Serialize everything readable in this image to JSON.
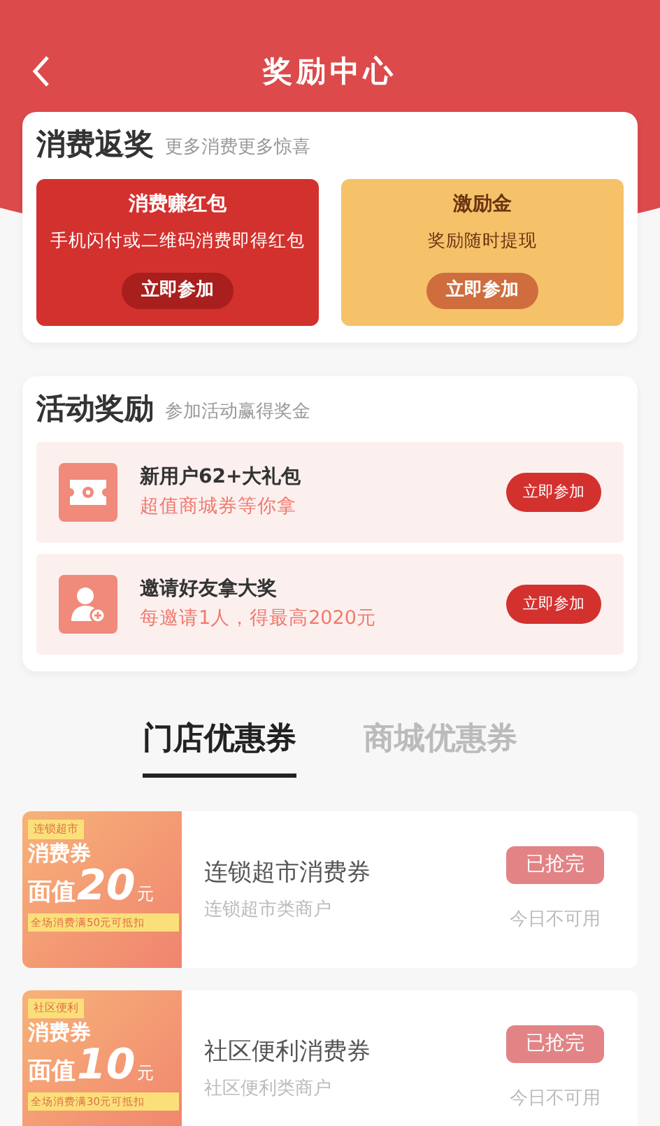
{
  "header": {
    "title": "奖励中心"
  },
  "consume_section": {
    "title": "消费返奖",
    "subtitle": "更多消费更多惊喜",
    "cards": [
      {
        "kind": "red",
        "title": "消费赚红包",
        "desc": "手机闪付或二维码消费即得红包",
        "button": "立即参加"
      },
      {
        "kind": "gold",
        "title": "激励金",
        "desc": "奖励随时提现",
        "button": "立即参加"
      }
    ]
  },
  "activity_section": {
    "title": "活动奖励",
    "subtitle": "参加活动赢得奖金",
    "items": [
      {
        "kind": "ticket",
        "title": "新用户62+大礼包",
        "desc": "超值商城券等你拿",
        "button": "立即参加"
      },
      {
        "kind": "invite",
        "title": "邀请好友拿大奖",
        "desc": "每邀请1人，得最高2020元",
        "button": "立即参加"
      }
    ]
  },
  "tabs": [
    {
      "label": "门店优惠券",
      "selected": true
    },
    {
      "label": "商城优惠券",
      "selected": false
    }
  ],
  "coupons": [
    {
      "tag": "连锁超市",
      "type_text": "消费券",
      "value_label": "面值",
      "amount": "20",
      "unit": "元",
      "condition": "全场消费满50元可抵扣",
      "title": "连锁超市消费券",
      "desc": "连锁超市类商户",
      "button": "已抢完",
      "disabled": true,
      "note": "今日不可用"
    },
    {
      "tag": "社区便利",
      "type_text": "消费券",
      "value_label": "面值",
      "amount": "10",
      "unit": "元",
      "condition": "全场消费满30元可抵扣",
      "title": "社区便利消费券",
      "desc": "社区便利类商户",
      "button": "已抢完",
      "disabled": true,
      "note": "今日不可用"
    }
  ]
}
